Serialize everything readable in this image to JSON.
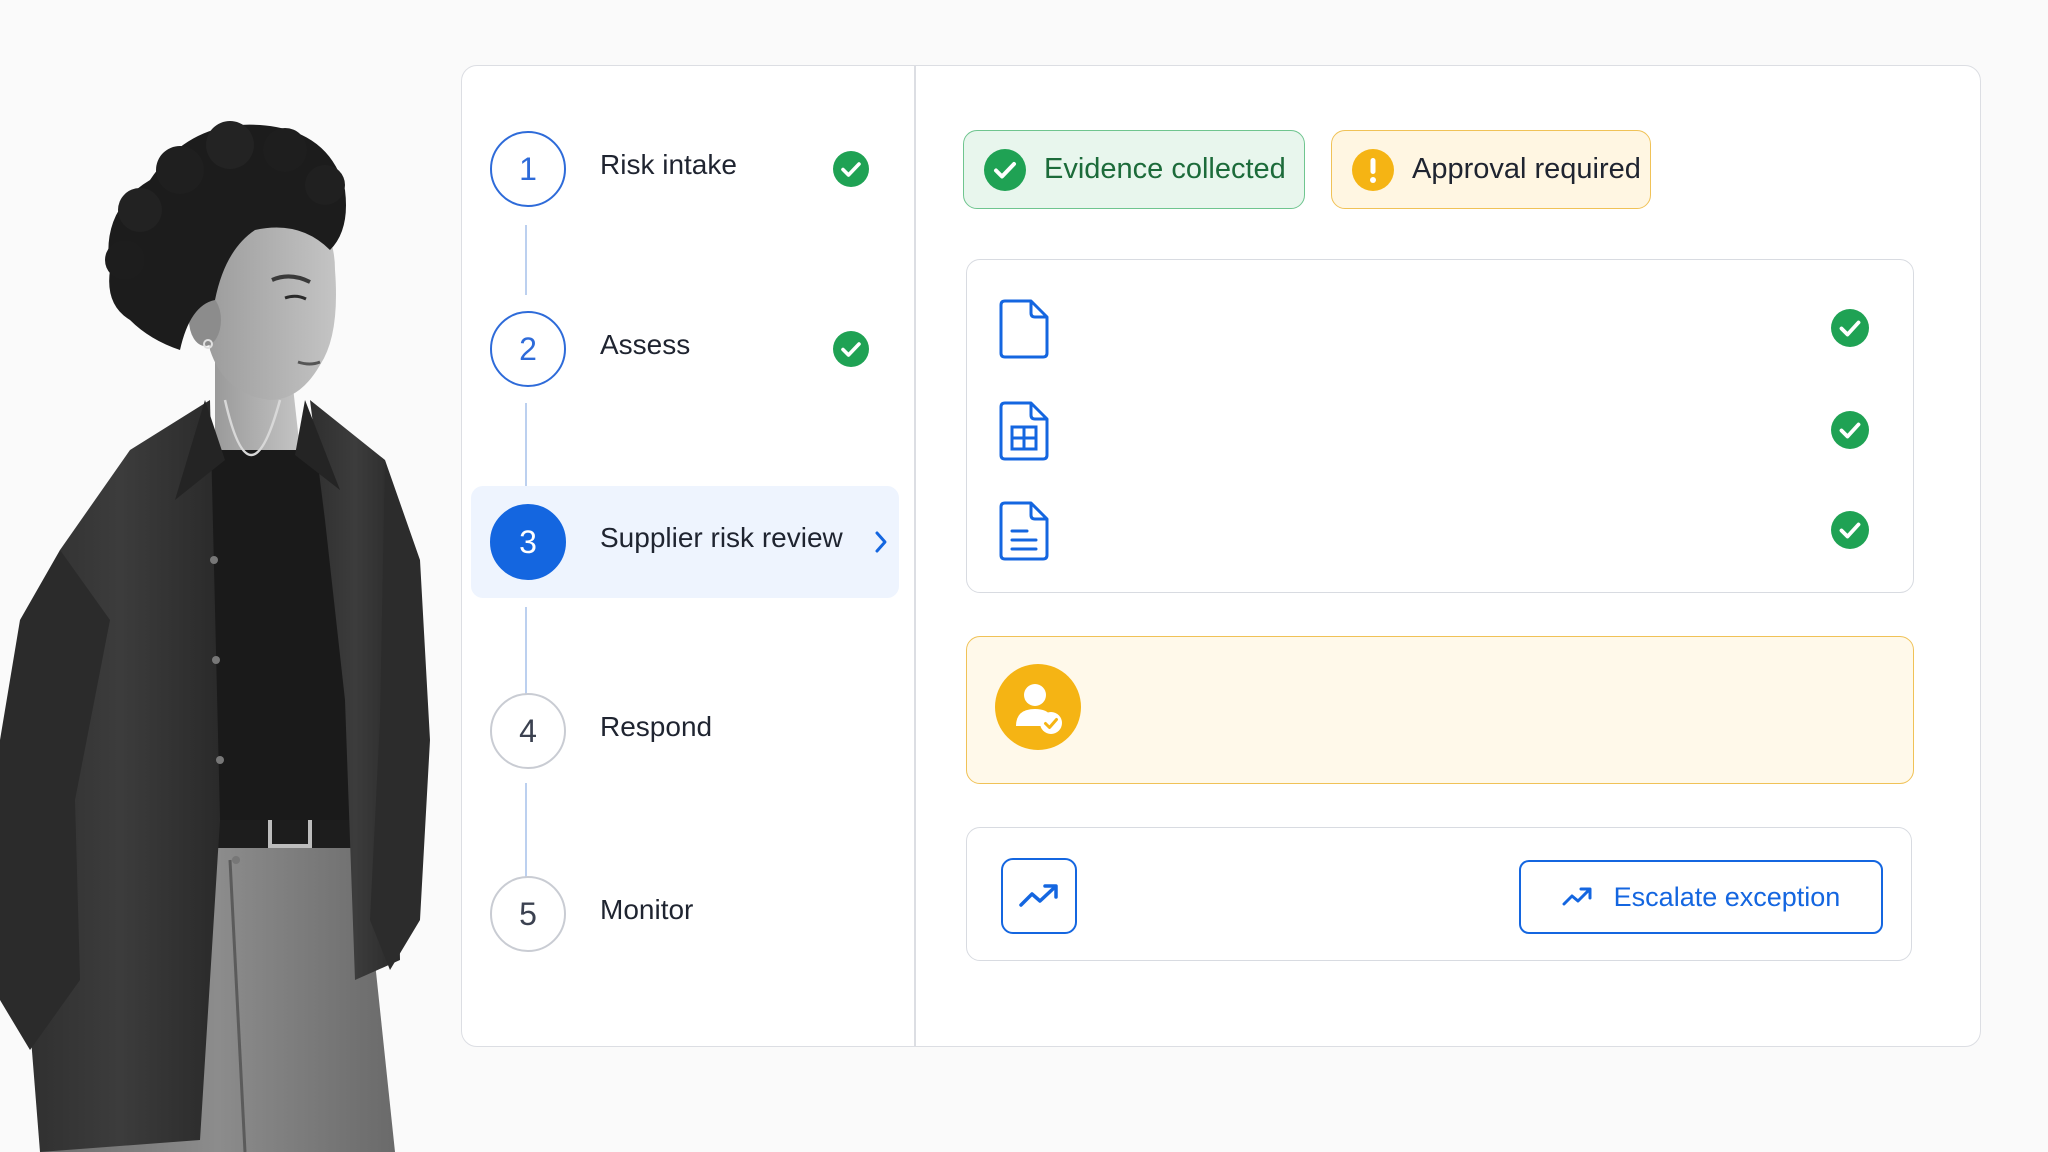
{
  "colors": {
    "accent": "#1466e0",
    "success": "#1fa254",
    "warning": "#f5b414",
    "active_bg": "#eef4fe"
  },
  "steps": [
    {
      "number": "1",
      "label": "Risk intake",
      "status": "complete",
      "icon": "check-circle-icon"
    },
    {
      "number": "2",
      "label": "Assess",
      "status": "complete",
      "icon": "check-circle-icon"
    },
    {
      "number": "3",
      "label": "Supplier risk review",
      "status": "active",
      "icon": "chevron-right-icon"
    },
    {
      "number": "4",
      "label": "Respond",
      "status": "pending"
    },
    {
      "number": "5",
      "label": "Monitor",
      "status": "pending"
    }
  ],
  "status_pills": {
    "evidence": {
      "label": "Evidence collected",
      "icon": "check-circle-icon"
    },
    "approval": {
      "label": "Approval required",
      "icon": "exclamation-circle-icon"
    }
  },
  "evidence_files": [
    {
      "icon": "document-icon",
      "status": "complete"
    },
    {
      "icon": "spreadsheet-icon",
      "status": "complete"
    },
    {
      "icon": "text-document-icon",
      "status": "complete"
    }
  ],
  "approver": {
    "icon": "user-check-icon"
  },
  "escalation": {
    "icon": "trending-up-icon",
    "button_label": "Escalate exception"
  }
}
